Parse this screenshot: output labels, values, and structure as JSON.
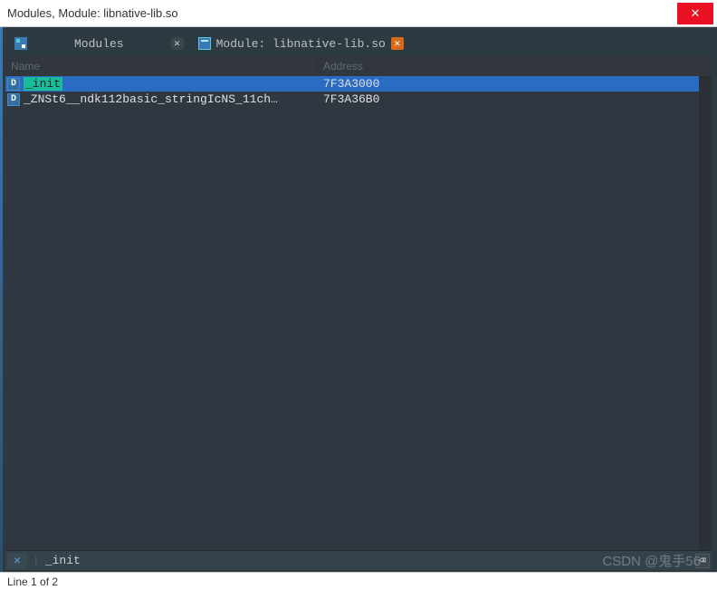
{
  "window": {
    "title": "Modules, Module: libnative-lib.so"
  },
  "tabs": {
    "modules_label": "Modules",
    "module_label": "Module: libnative-lib.so"
  },
  "table": {
    "headers": {
      "name": "Name",
      "address": "Address"
    },
    "rows": [
      {
        "badge": "D",
        "name": "_init",
        "address": "7F3A3000",
        "selected": true,
        "highlighted": true
      },
      {
        "badge": "D",
        "name": "_ZNSt6__ndk112basic_stringIcNS_11ch…",
        "address": "7F3A36B0",
        "selected": false,
        "highlighted": false
      }
    ]
  },
  "search": {
    "value": "_init"
  },
  "status": {
    "line_info": "Line 1 of 2"
  },
  "watermark": "CSDN @鬼手56"
}
